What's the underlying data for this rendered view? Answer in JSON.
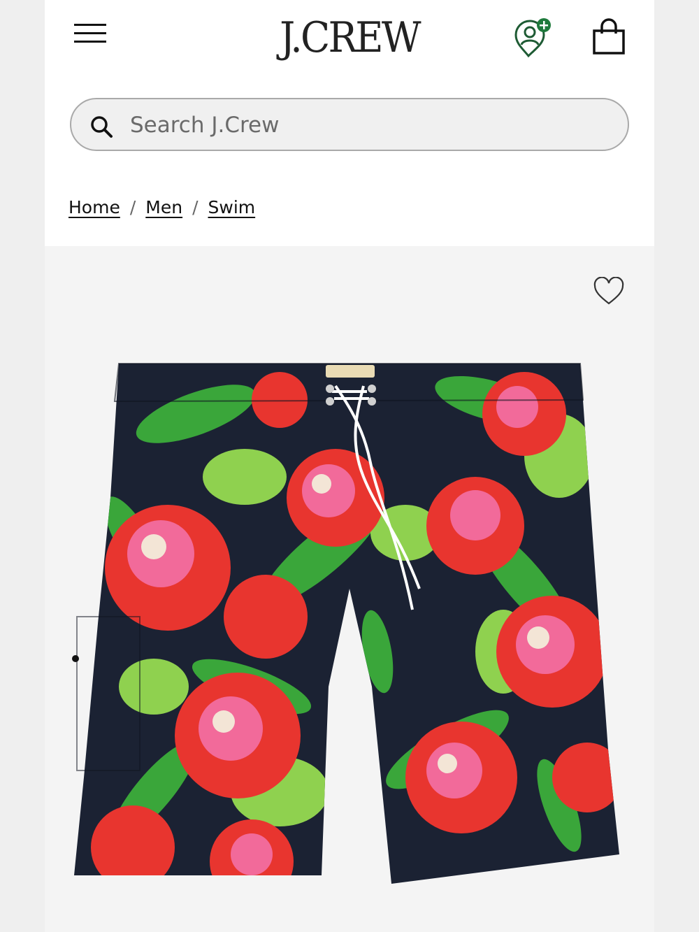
{
  "header": {
    "logo_text": "J.CREW",
    "icons": [
      "menu-icon",
      "account-rewards-icon",
      "shopping-bag-icon"
    ]
  },
  "search": {
    "placeholder": "Search J.Crew",
    "value": ""
  },
  "breadcrumb": {
    "items": [
      {
        "label": "Home"
      },
      {
        "label": "Men"
      },
      {
        "label": "Swim"
      }
    ],
    "separator": "/"
  },
  "product": {
    "image_alt": "Floral hibiscus board shorts",
    "wishlist_icon": "heart-icon"
  },
  "colors": {
    "brand_green": "#2e7d32",
    "text": "#111111",
    "background": "#efefef"
  }
}
